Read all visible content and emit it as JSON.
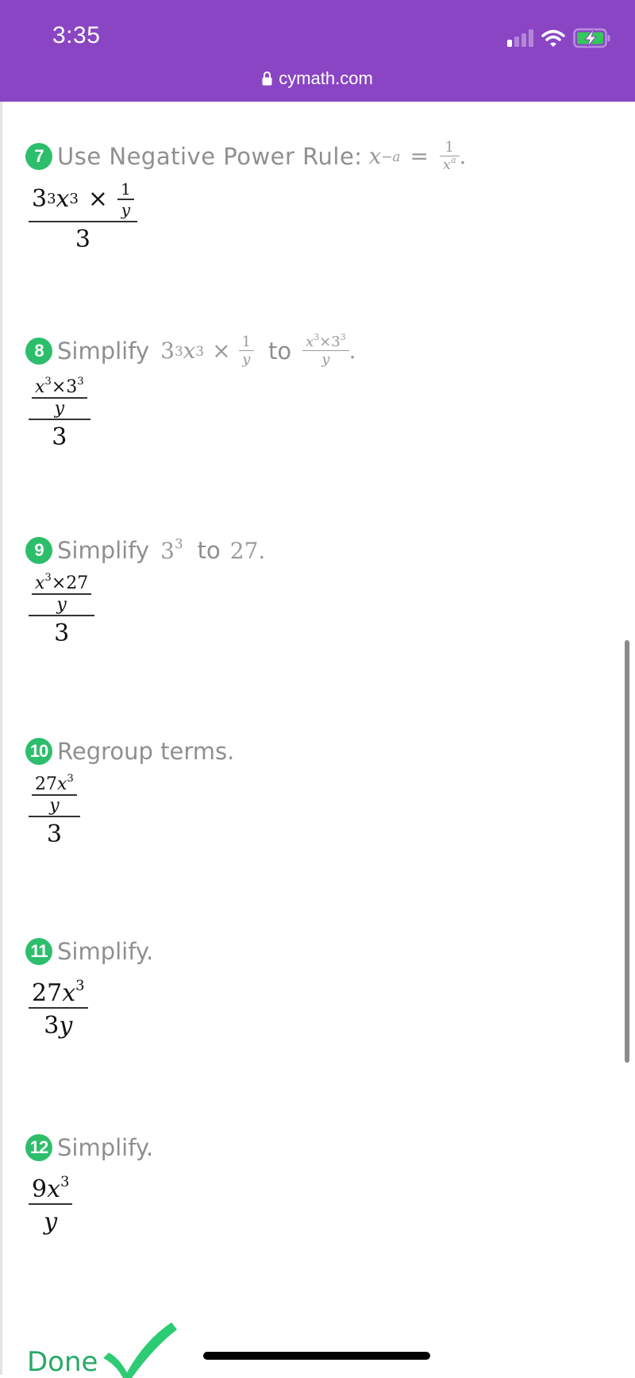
{
  "status_bar": {
    "time": "3:35",
    "signal_bars_active": 1,
    "signal_bars_total": 4,
    "wifi_icon": "wifi-icon",
    "battery_icon": "battery-charging-icon",
    "battery_color": "#34c759",
    "url": "cymath.com",
    "lock_icon": "lock-icon",
    "background_color": "#8a45c4"
  },
  "steps": [
    {
      "number": "7",
      "label": "Use Negative Power Rule:",
      "rule": {
        "lhs_base": "x",
        "lhs_exp": "−a",
        "eq": "=",
        "num": "1",
        "den_base": "x",
        "den_exp": "a",
        "end": "."
      },
      "result": {
        "num_a": "3",
        "num_a_exp": "3",
        "num_b": "x",
        "num_b_exp": "3",
        "times": "×",
        "inner_num": "1",
        "inner_den": "y",
        "den": "3"
      }
    },
    {
      "number": "8",
      "label": "Simplify",
      "expr": {
        "a": "3",
        "a_exp": "3",
        "b": "x",
        "b_exp": "3",
        "times": "×",
        "inner_num": "1",
        "inner_den": "y"
      },
      "to": "to",
      "target": {
        "num": "x³×3³",
        "x": "x",
        "x_exp": "3",
        "times": "×",
        "c": "3",
        "c_exp": "3",
        "den": "y"
      },
      "end": ".",
      "result": {
        "x": "x",
        "x_exp": "3",
        "times": "×",
        "c": "3",
        "c_exp": "3",
        "inner_den": "y",
        "den": "3"
      }
    },
    {
      "number": "9",
      "label": "Simplify",
      "expr": {
        "base": "3",
        "exp": "3"
      },
      "to": "to",
      "target": "27",
      "end": ".",
      "result": {
        "x": "x",
        "x_exp": "3",
        "times": "×",
        "c": "27",
        "inner_den": "y",
        "den": "3"
      }
    },
    {
      "number": "10",
      "label": "Regroup terms.",
      "result": {
        "coef": "27",
        "x": "x",
        "x_exp": "3",
        "inner_den": "y",
        "den": "3"
      }
    },
    {
      "number": "11",
      "label": "Simplify.",
      "result": {
        "coef": "27",
        "x": "x",
        "x_exp": "3",
        "den_coef": "3",
        "den_var": "y"
      }
    },
    {
      "number": "12",
      "label": "Simplify.",
      "result": {
        "coef": "9",
        "x": "x",
        "x_exp": "3",
        "den_var": "y"
      }
    }
  ],
  "done": {
    "label": "Done",
    "icon": "checkmark-icon",
    "color": "#2dbe6c"
  },
  "accent_badge_color": "#2dbe6c"
}
